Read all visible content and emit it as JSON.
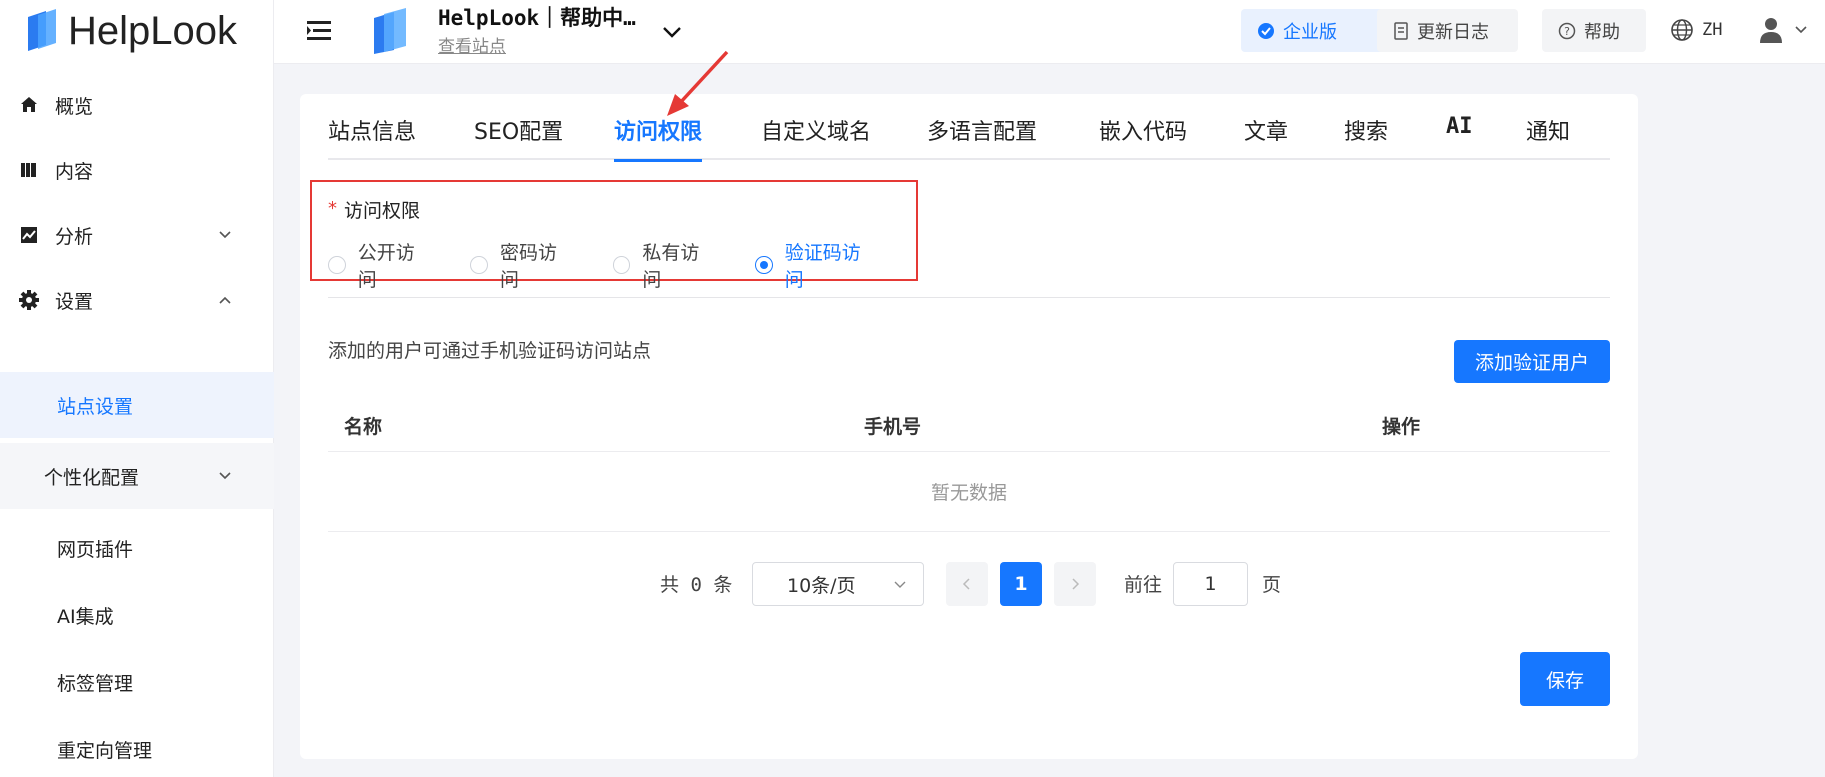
{
  "brand": {
    "name": "HelpLook"
  },
  "sidebar": {
    "items": [
      {
        "label": "概览",
        "icon": "home-icon"
      },
      {
        "label": "内容",
        "icon": "book-icon"
      },
      {
        "label": "分析",
        "icon": "chart-icon"
      },
      {
        "label": "设置",
        "icon": "gear-icon"
      }
    ],
    "sub_items": [
      {
        "label": "站点设置",
        "active": true
      },
      {
        "label": "个性化配置",
        "group": true
      },
      {
        "label": "网页插件"
      },
      {
        "label": "AI集成"
      },
      {
        "label": "标签管理"
      },
      {
        "label": "重定向管理"
      }
    ]
  },
  "header": {
    "site_title": "HelpLook｜帮助中…",
    "site_link": "查看站点",
    "enterprise": "企业版",
    "changelog": "更新日志",
    "help": "帮助",
    "lang": "ZH"
  },
  "tabs": [
    "站点信息",
    "SEO配置",
    "访问权限",
    "自定义域名",
    "多语言配置",
    "嵌入代码",
    "文章",
    "搜索",
    "AI",
    "通知"
  ],
  "active_tab": "访问权限",
  "access": {
    "label": "访问权限",
    "options": [
      "公开访问",
      "密码访问",
      "私有访问",
      "验证码访问"
    ],
    "selected": "验证码访问"
  },
  "verify_users": {
    "hint": "添加的用户可通过手机验证码访问站点",
    "add_button": "添加验证用户",
    "columns": [
      "名称",
      "手机号",
      "操作"
    ],
    "empty_text": "暂无数据"
  },
  "pagination": {
    "total": "共 0 条",
    "page_size": "10条/页",
    "current_page": "1",
    "goto_label": "前往",
    "goto_value": "1",
    "page_suffix": "页"
  },
  "save_button": "保存",
  "colors": {
    "accent": "#1677ff",
    "annotation": "#e53935"
  }
}
